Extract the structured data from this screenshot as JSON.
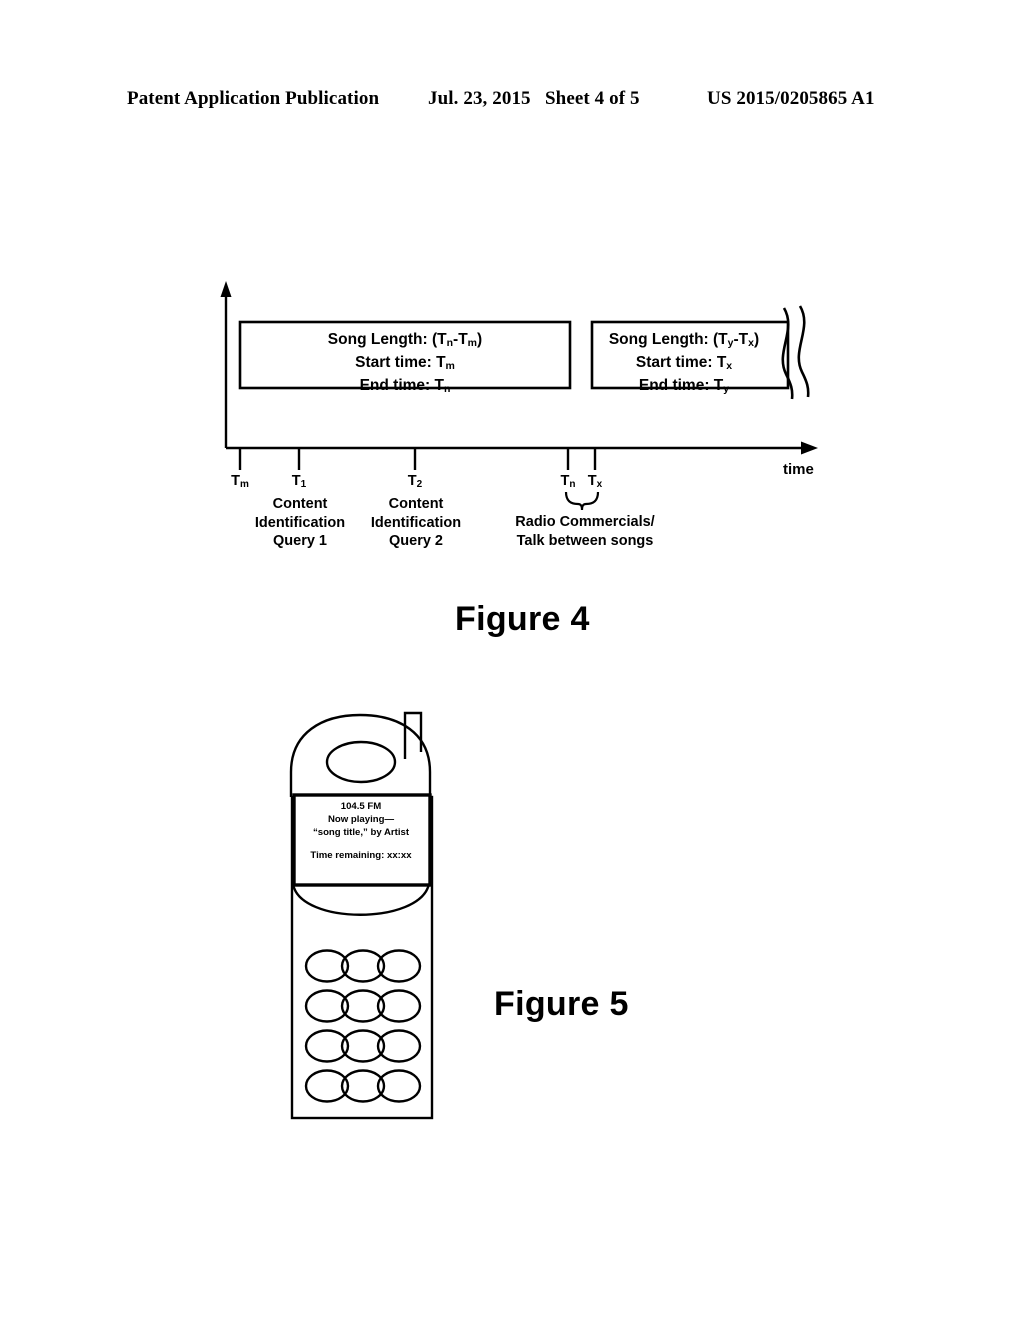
{
  "header": {
    "publication": "Patent Application Publication",
    "date": "Jul. 23, 2015",
    "sheet": "Sheet 4 of 5",
    "number": "US 2015/0205865 A1"
  },
  "figure4": {
    "caption": "Figure 4",
    "axis_label": "time",
    "box1": {
      "line1_prefix": "Song Length: (T",
      "line1_sub1": "n",
      "line1_mid": "-T",
      "line1_sub2": "m",
      "line1_suffix": ")",
      "line2_prefix": "Start time: T",
      "line2_sub": "m",
      "line3_prefix": "End time: T",
      "line3_sub": "n"
    },
    "box2": {
      "line1_prefix": "Song Length: (T",
      "line1_sub1": "y",
      "line1_mid": "-T",
      "line1_sub2": "x",
      "line1_suffix": ")",
      "line2_prefix": "Start time: T",
      "line2_sub": "x",
      "line3_prefix": "End time: T",
      "line3_sub": "y"
    },
    "ticks": [
      {
        "base": "T",
        "sub": "m"
      },
      {
        "base": "T",
        "sub": "1"
      },
      {
        "base": "T",
        "sub": "2"
      },
      {
        "base": "T",
        "sub": "n"
      },
      {
        "base": "T",
        "sub": "x"
      }
    ],
    "captions": {
      "query1_line1": "Content",
      "query1_line2": "Identification",
      "query1_line3": "Query 1",
      "query2_line1": "Content",
      "query2_line2": "Identification",
      "query2_line3": "Query 2",
      "commercials_line1": "Radio Commercials/",
      "commercials_line2": "Talk between songs"
    }
  },
  "figure5": {
    "caption": "Figure 5",
    "screen": {
      "station": "104.5 FM",
      "now_playing": "Now playing—",
      "track": "“song title,” by Artist",
      "time_remaining": "Time remaining: xx:xx"
    },
    "keypad_rows": 4,
    "keypad_cols": 3
  },
  "colors": {
    "ink": "#000000",
    "page": "#ffffff"
  }
}
